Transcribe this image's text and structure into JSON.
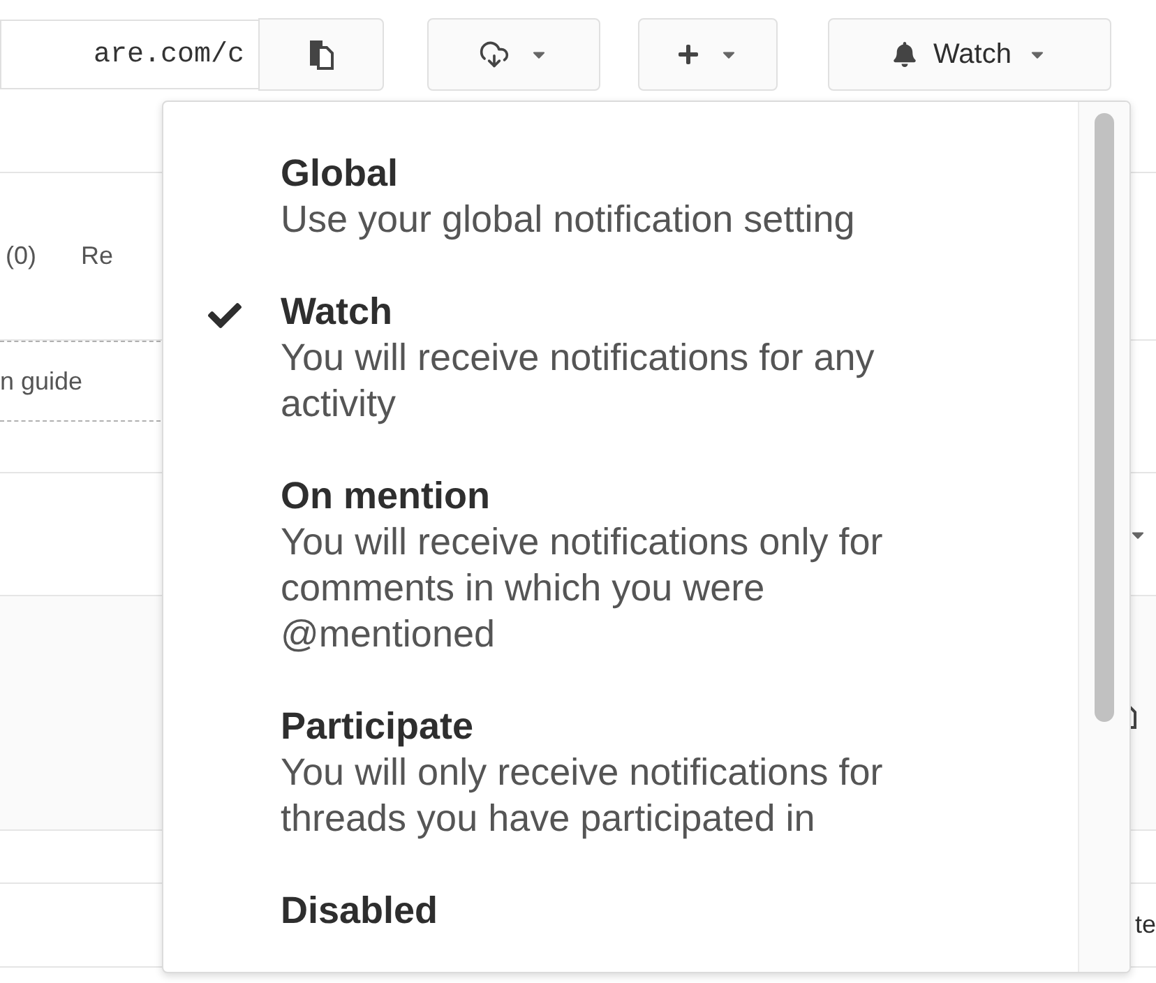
{
  "toolbar": {
    "url": "are.com/c",
    "watch_label": "Watch"
  },
  "background": {
    "count": "(0)",
    "tab_partial": "Re",
    "link": "n guide",
    "right_partial": "te"
  },
  "menu": {
    "items": [
      {
        "title": "Global",
        "description": "Use your global notification setting",
        "selected": false
      },
      {
        "title": "Watch",
        "description": "You will receive notifications for any activity",
        "selected": true
      },
      {
        "title": "On mention",
        "description": "You will receive notifications only for comments in which you were @mentioned",
        "selected": false
      },
      {
        "title": "Participate",
        "description": "You will only receive notifications for threads you have participated in",
        "selected": false
      },
      {
        "title": "Disabled",
        "selected": false
      }
    ]
  }
}
